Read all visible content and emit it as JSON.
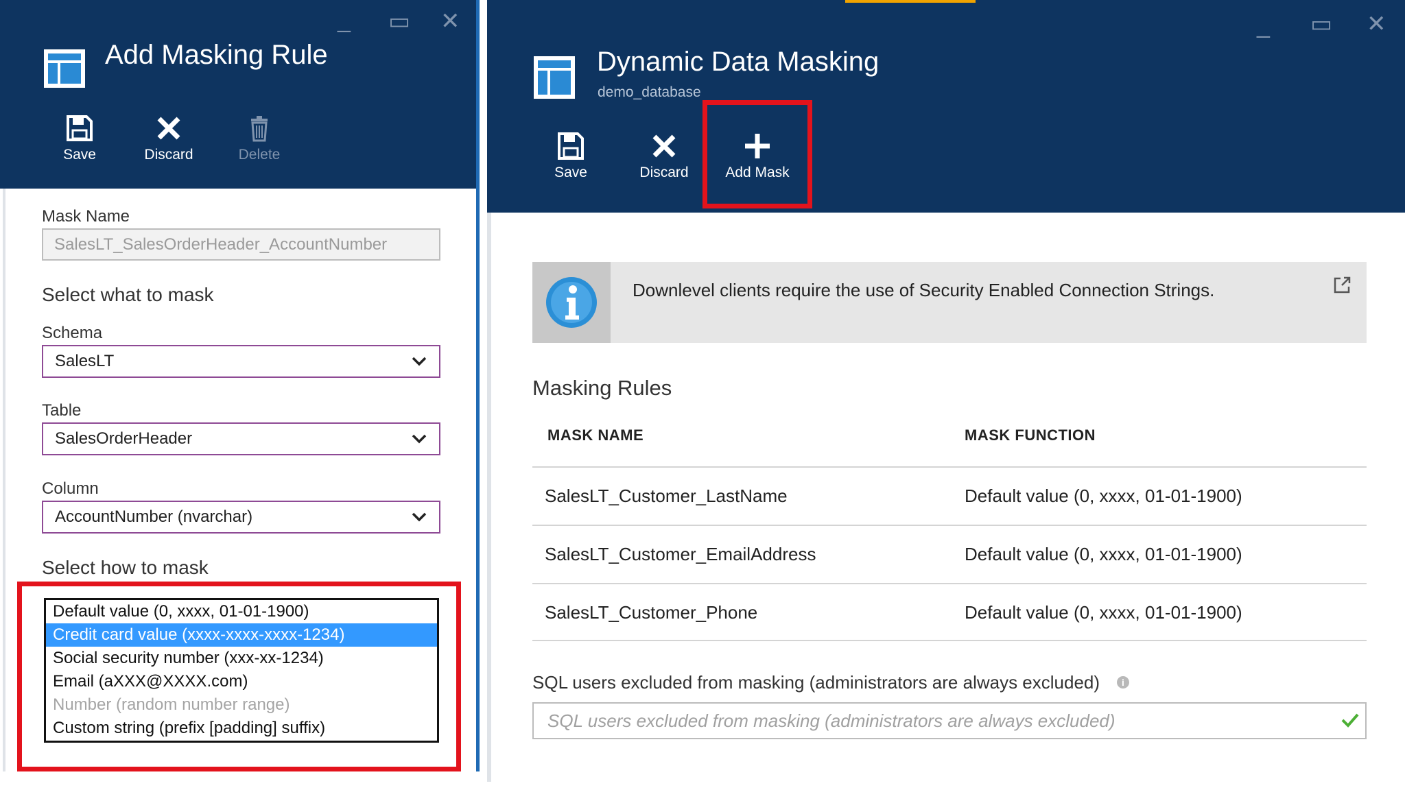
{
  "left_blade": {
    "title": "Add Masking Rule",
    "window_controls": {
      "minimize": "_",
      "maximize": "▭",
      "close": "✕"
    },
    "commands": [
      {
        "label": "Save",
        "icon": "save-icon",
        "enabled": true
      },
      {
        "label": "Discard",
        "icon": "close-icon",
        "enabled": true
      },
      {
        "label": "Delete",
        "icon": "trash-icon",
        "enabled": false
      }
    ],
    "mask_name_label": "Mask Name",
    "mask_name_value": "SalesLT_SalesOrderHeader_AccountNumber",
    "select_what_heading": "Select what to mask",
    "schema_label": "Schema",
    "schema_value": "SalesLT",
    "table_label": "Table",
    "table_value": "SalesOrderHeader",
    "column_label": "Column",
    "column_value": "AccountNumber (nvarchar)",
    "select_how_heading": "Select how to mask",
    "mask_functions": [
      {
        "label": "Default value (0, xxxx, 01-01-1900)",
        "state": "normal"
      },
      {
        "label": "Credit card value (xxxx-xxxx-xxxx-1234)",
        "state": "selected"
      },
      {
        "label": "Social security number (xxx-xx-1234)",
        "state": "normal"
      },
      {
        "label": "Email (aXXX@XXXX.com)",
        "state": "normal"
      },
      {
        "label": "Number (random number range)",
        "state": "disabled"
      },
      {
        "label": "Custom string (prefix [padding] suffix)",
        "state": "normal"
      }
    ]
  },
  "right_blade": {
    "title": "Dynamic Data Masking",
    "subtitle": "demo_database",
    "window_controls": {
      "minimize": "_",
      "maximize": "▭",
      "close": "✕"
    },
    "commands": [
      {
        "label": "Save",
        "icon": "save-icon"
      },
      {
        "label": "Discard",
        "icon": "close-icon"
      },
      {
        "label": "Add Mask",
        "icon": "plus-icon"
      }
    ],
    "info_banner_text": "Downlevel clients require the use of Security Enabled Connection Strings.",
    "rules_title": "Masking Rules",
    "table_headers": {
      "name": "MASK NAME",
      "function": "MASK FUNCTION"
    },
    "rules": [
      {
        "name": "SalesLT_Customer_LastName",
        "function": "Default value (0, xxxx, 01-01-1900)"
      },
      {
        "name": "SalesLT_Customer_EmailAddress",
        "function": "Default value (0, xxxx, 01-01-1900)"
      },
      {
        "name": "SalesLT_Customer_Phone",
        "function": "Default value (0, xxxx, 01-01-1900)"
      }
    ],
    "excluded_users_label": "SQL users excluded from masking (administrators are always excluded)",
    "excluded_users_placeholder": "SQL users excluded from masking (administrators are always excluded)",
    "excluded_users_info": "i"
  },
  "colors": {
    "header_bg": "#0e3460",
    "highlight_red": "#e3131c",
    "selected_blue": "#3399ff",
    "select_border": "#8e4a95",
    "valid_green": "#4caf35"
  }
}
